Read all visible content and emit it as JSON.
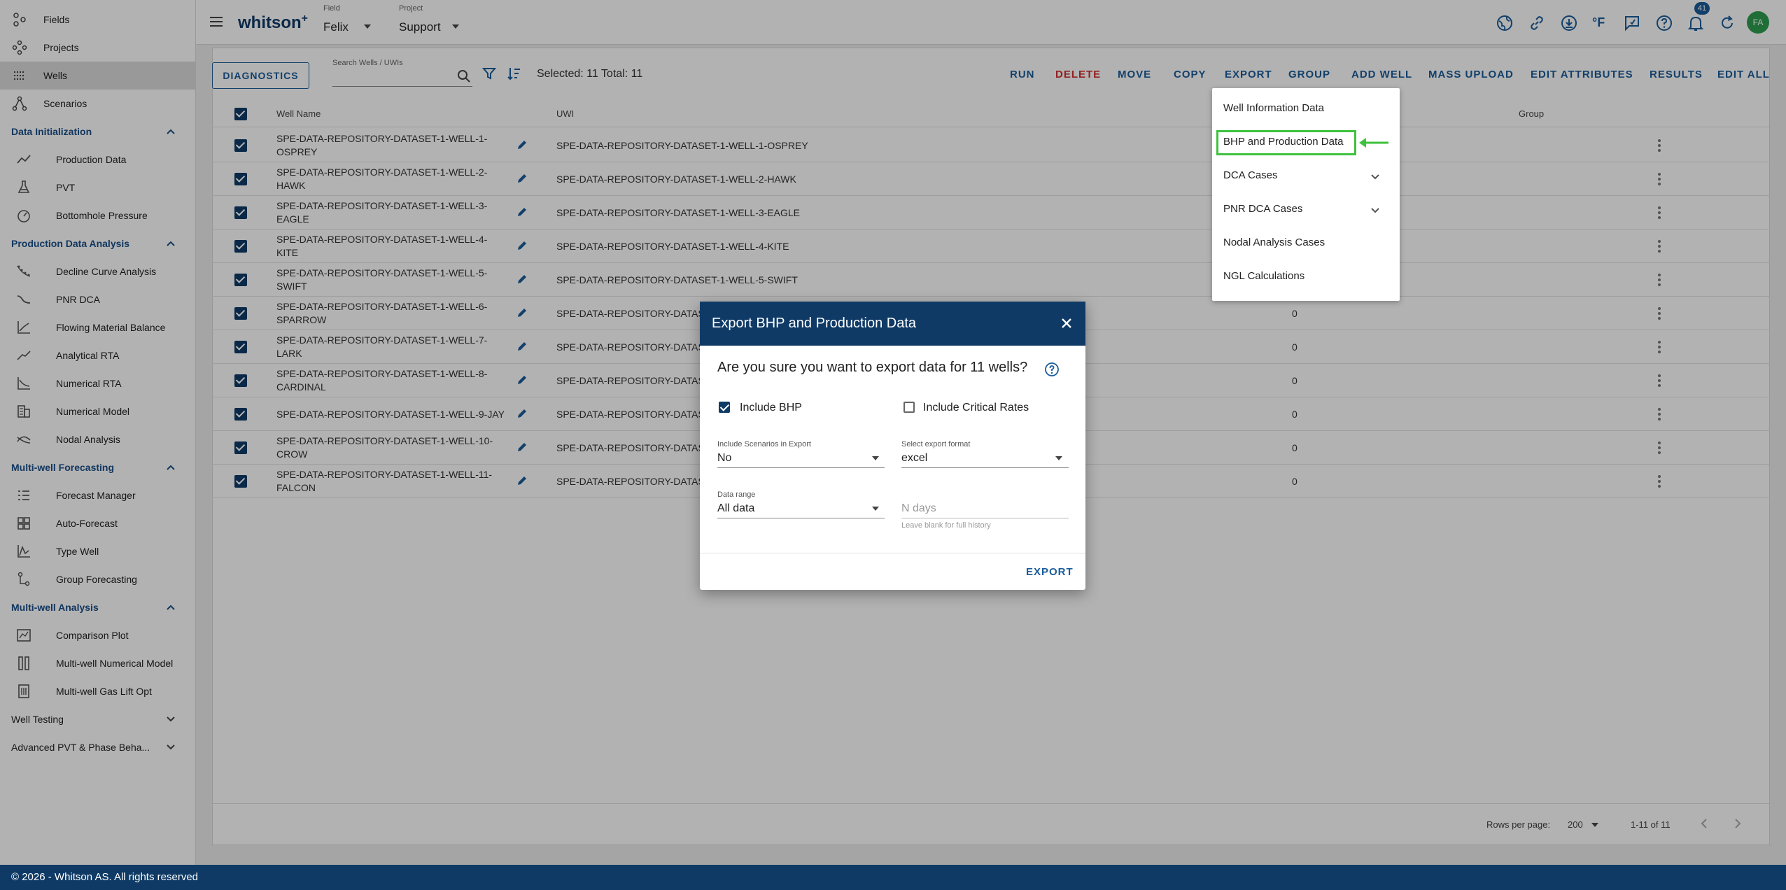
{
  "sidebar": {
    "top_items": [
      {
        "label": "Fields",
        "icon": "fields-icon"
      },
      {
        "label": "Projects",
        "icon": "projects-icon"
      },
      {
        "label": "Wells",
        "icon": "wells-icon",
        "active": true
      },
      {
        "label": "Scenarios",
        "icon": "scenarios-icon"
      }
    ],
    "sections": [
      {
        "label": "Data Initialization",
        "items": [
          "Production Data",
          "PVT",
          "Bottomhole Pressure"
        ]
      },
      {
        "label": "Production Data Analysis",
        "items": [
          "Decline Curve Analysis",
          "PNR DCA",
          "Flowing Material Balance",
          "Analytical RTA",
          "Numerical RTA",
          "Numerical Model",
          "Nodal Analysis"
        ]
      },
      {
        "label": "Multi-well Forecasting",
        "items": [
          "Forecast Manager",
          "Auto-Forecast",
          "Type Well",
          "Group Forecasting"
        ]
      },
      {
        "label": "Multi-well Analysis",
        "items": [
          "Comparison Plot",
          "Multi-well Numerical Model",
          "Multi-well Gas Lift Opt"
        ]
      }
    ],
    "collapsed_sections": [
      "Well Testing",
      "Advanced PVT & Phase Beha..."
    ]
  },
  "header": {
    "brand": "whitson",
    "brand_sup": "+",
    "field_label": "Field",
    "field_value": "Felix",
    "project_label": "Project",
    "project_value": "Support",
    "notification_count": "41",
    "avatar_initials": "FA",
    "temp_unit": "°F"
  },
  "toolbar": {
    "diagnostics": "DIAGNOSTICS",
    "search_placeholder": "Search Wells / UWIs",
    "selection": "Selected: 11 Total: 11",
    "actions": [
      "RUN",
      "DELETE",
      "MOVE",
      "COPY",
      "EXPORT",
      "GROUP",
      "ADD WELL",
      "MASS UPLOAD",
      "EDIT ATTRIBUTES",
      "RESULTS",
      "EDIT ALL"
    ]
  },
  "table": {
    "col_name": "Well Name",
    "col_uwi": "UWI",
    "col_group": "Group",
    "rows": [
      {
        "name": "SPE-DATA-REPOSITORY-DATASET-1-WELL-1-OSPREY",
        "uwi": "SPE-DATA-REPOSITORY-DATASET-1-WELL-1-OSPREY",
        "value": ""
      },
      {
        "name": "SPE-DATA-REPOSITORY-DATASET-1-WELL-2-HAWK",
        "uwi": "SPE-DATA-REPOSITORY-DATASET-1-WELL-2-HAWK",
        "value": ""
      },
      {
        "name": "SPE-DATA-REPOSITORY-DATASET-1-WELL-3-EAGLE",
        "uwi": "SPE-DATA-REPOSITORY-DATASET-1-WELL-3-EAGLE",
        "value": ""
      },
      {
        "name": "SPE-DATA-REPOSITORY-DATASET-1-WELL-4-KITE",
        "uwi": "SPE-DATA-REPOSITORY-DATASET-1-WELL-4-KITE",
        "value": ""
      },
      {
        "name": "SPE-DATA-REPOSITORY-DATASET-1-WELL-5-SWIFT",
        "uwi": "SPE-DATA-REPOSITORY-DATASET-1-WELL-5-SWIFT",
        "value": ""
      },
      {
        "name": "SPE-DATA-REPOSITORY-DATASET-1-WELL-6-SPARROW",
        "uwi": "SPE-DATA-REPOSITORY-DATASET",
        "value": "0"
      },
      {
        "name": "SPE-DATA-REPOSITORY-DATASET-1-WELL-7-LARK",
        "uwi": "SPE-DATA-REPOSITORY-DATASET",
        "value": "0"
      },
      {
        "name": "SPE-DATA-REPOSITORY-DATASET-1-WELL-8-CARDINAL",
        "uwi": "SPE-DATA-REPOSITORY-DATASET",
        "value": "0"
      },
      {
        "name": "SPE-DATA-REPOSITORY-DATASET-1-WELL-9-JAY",
        "uwi": "SPE-DATA-REPOSITORY-DATASET",
        "value": "0"
      },
      {
        "name": "SPE-DATA-REPOSITORY-DATASET-1-WELL-10-CROW",
        "uwi": "SPE-DATA-REPOSITORY-DATASET",
        "value": "0"
      },
      {
        "name": "SPE-DATA-REPOSITORY-DATASET-1-WELL-11-FALCON",
        "uwi": "SPE-DATA-REPOSITORY-DATASET",
        "value": "0"
      }
    ]
  },
  "export_menu": {
    "items": [
      {
        "label": "Well Information Data",
        "has_chevron": false
      },
      {
        "label": "BHP and Production Data",
        "has_chevron": false,
        "highlighted": true
      },
      {
        "label": "DCA Cases",
        "has_chevron": true
      },
      {
        "label": "PNR DCA Cases",
        "has_chevron": true
      },
      {
        "label": "Nodal Analysis Cases",
        "has_chevron": false
      },
      {
        "label": "NGL Calculations",
        "has_chevron": false
      }
    ]
  },
  "dialog": {
    "title": "Export BHP and Production Data",
    "question": "Are you sure you want to export data for 11 wells?",
    "include_bhp": "Include BHP",
    "include_bhp_checked": true,
    "include_critical": "Include Critical Rates",
    "include_critical_checked": false,
    "scenarios_label": "Include Scenarios in Export",
    "scenarios_value": "No",
    "format_label": "Select export format",
    "format_value": "excel",
    "range_label": "Data range",
    "range_value": "All data",
    "ndays_placeholder": "N days",
    "ndays_hint": "Leave blank for full history",
    "export_button": "EXPORT"
  },
  "pagination": {
    "rows_per_page_label": "Rows per page:",
    "rows_per_page": "200",
    "range": "1-11 of 11"
  },
  "footer": {
    "text": "© 2026 - Whitson AS. All rights reserved"
  },
  "colors": {
    "primary": "#0f3a66",
    "accent": "#1a5c9a",
    "danger": "#d32f2f",
    "highlight": "#3ec23e",
    "avatar": "#2e9e4f"
  }
}
